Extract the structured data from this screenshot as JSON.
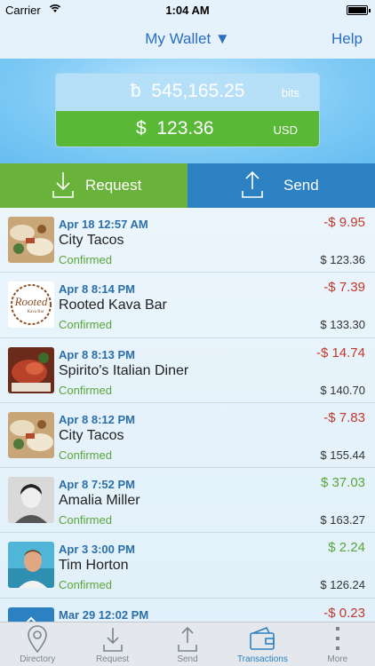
{
  "status_bar": {
    "carrier": "Carrier",
    "time": "1:04 AM"
  },
  "nav": {
    "title": "My Wallet ▼",
    "help": "Help"
  },
  "balance": {
    "bits_symbol": "ƀ",
    "bits_amount": "545,165.25",
    "bits_unit": "bits",
    "usd_symbol": "$",
    "usd_amount": "123.36",
    "usd_unit": "USD"
  },
  "actions": {
    "request": "Request",
    "send": "Send"
  },
  "transactions": [
    {
      "date": "Apr 18 12:57 AM",
      "name": "City Tacos",
      "status": "Confirmed",
      "amount": "-$ 9.95",
      "balance": "$ 123.36",
      "avatar": "tacos"
    },
    {
      "date": "Apr 8 8:14 PM",
      "name": "Rooted Kava Bar",
      "status": "Confirmed",
      "amount": "-$ 7.39",
      "balance": "$ 133.30",
      "avatar": "rooted"
    },
    {
      "date": "Apr 8 8:13 PM",
      "name": "Spirito's Italian Diner",
      "status": "Confirmed",
      "amount": "-$ 14.74",
      "balance": "$ 140.70",
      "avatar": "food"
    },
    {
      "date": "Apr 8 8:12 PM",
      "name": "City Tacos",
      "status": "Confirmed",
      "amount": "-$ 7.83",
      "balance": "$ 155.44",
      "avatar": "tacos"
    },
    {
      "date": "Apr 8 7:52 PM",
      "name": "Amalia Miller",
      "status": "Confirmed",
      "amount": "$ 37.03",
      "balance": "$ 163.27",
      "avatar": "person-bw"
    },
    {
      "date": "Apr 3 3:00 PM",
      "name": "Tim Horton",
      "status": "Confirmed",
      "amount": "$ 2.24",
      "balance": "$ 126.24",
      "avatar": "person-beach"
    },
    {
      "date": "Mar 29 12:02 PM",
      "name": "",
      "status": "",
      "amount": "-$ 0.23",
      "balance": "",
      "avatar": "blue"
    }
  ],
  "rooted_logo_text": "Rooted",
  "rooted_logo_sub": "Kava Bar",
  "tabs": [
    {
      "label": "Directory",
      "icon": "map-pin-icon"
    },
    {
      "label": "Request",
      "icon": "download-icon"
    },
    {
      "label": "Send",
      "icon": "upload-icon"
    },
    {
      "label": "Transactions",
      "icon": "wallet-icon"
    },
    {
      "label": "More",
      "icon": "more-dots-icon"
    }
  ],
  "colors": {
    "accent": "#2c6fbf",
    "request_green": "#6ab33a",
    "send_blue": "#2b81c2",
    "negative": "#c0392b",
    "positive": "#5aa639"
  }
}
